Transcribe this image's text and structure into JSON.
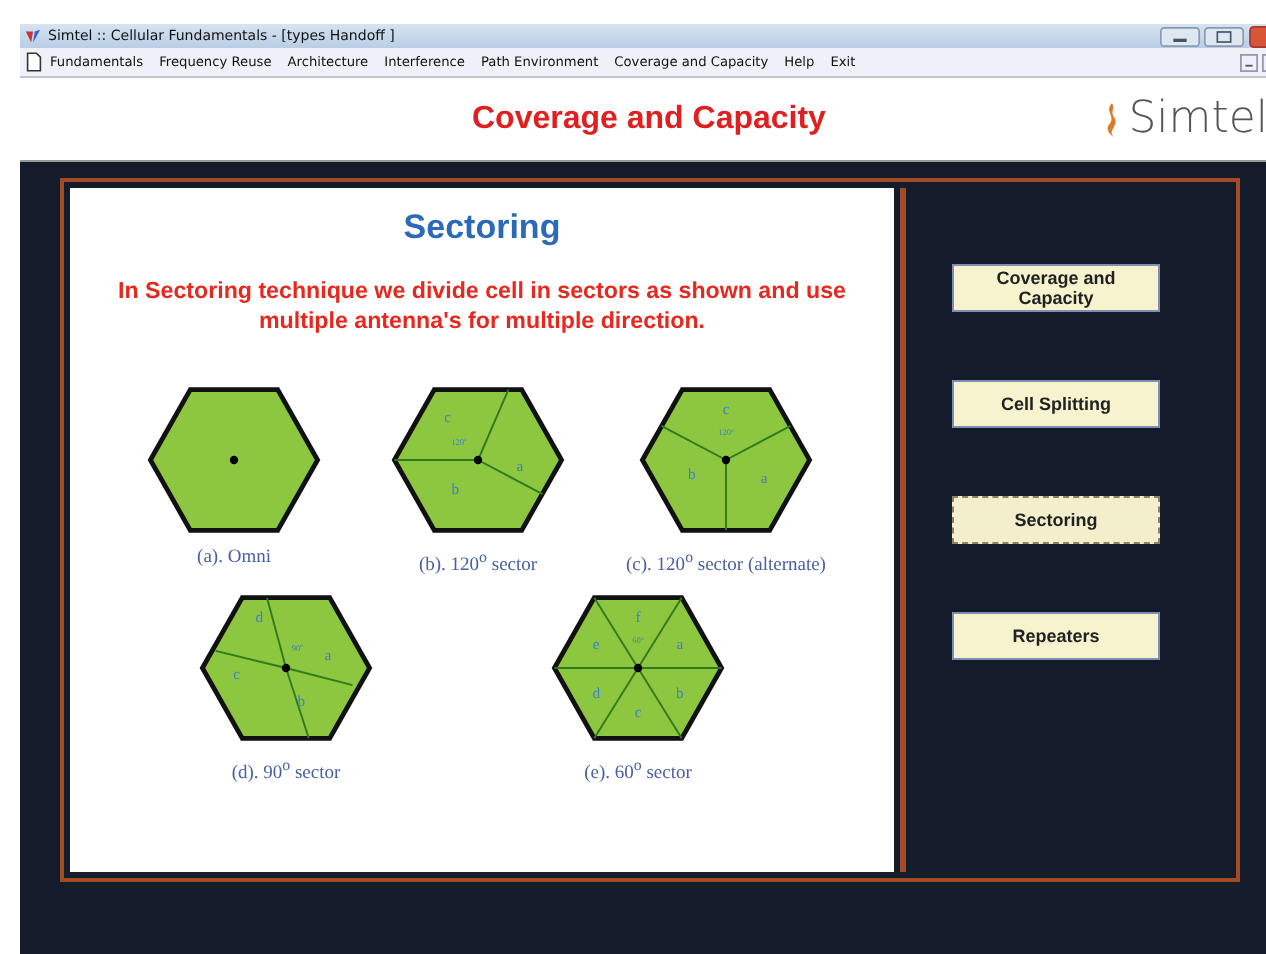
{
  "window": {
    "title": "Simtel :: Cellular Fundamentals - [types Handoff ]"
  },
  "menu": [
    "Fundamentals",
    "Frequency Reuse",
    "Architecture",
    "Interference",
    "Path Environment",
    "Coverage and Capacity",
    "Help",
    "Exit"
  ],
  "header": {
    "title": "Coverage and Capacity",
    "logo": "Simtel"
  },
  "slide": {
    "title": "Sectoring",
    "text": "In Sectoring technique we divide cell in sectors as shown and use multiple antenna's for multiple direction.",
    "diagrams": [
      {
        "kind": "omni",
        "caption": "(a). Omni"
      },
      {
        "kind": "sector3",
        "caption": "(b). 120$^{o}$ sector",
        "angle": "120$^{o}$",
        "labels": [
          "c",
          "a",
          "b"
        ]
      },
      {
        "kind": "sector3alt",
        "caption": "(c). 120$^{o}$ sector (alternate)",
        "angle": "120$^{o}$",
        "labels": [
          "c",
          "a",
          "b"
        ]
      },
      {
        "kind": "sector4",
        "caption": "(d). 90$^{o}$ sector",
        "angle": "90$^{o}$",
        "labels": [
          "d",
          "a",
          "b",
          "c"
        ]
      },
      {
        "kind": "sector6",
        "caption": "(e). 60$^{o}$ sector",
        "angle": "60$^{o}$",
        "labels": [
          "f",
          "a",
          "b",
          "c",
          "d",
          "e"
        ]
      }
    ]
  },
  "buttons": [
    {
      "label": "Coverage and Capacity",
      "selected": false
    },
    {
      "label": "Cell Splitting",
      "selected": false
    },
    {
      "label": "Sectoring",
      "selected": true
    },
    {
      "label": "Repeaters",
      "selected": false
    }
  ]
}
